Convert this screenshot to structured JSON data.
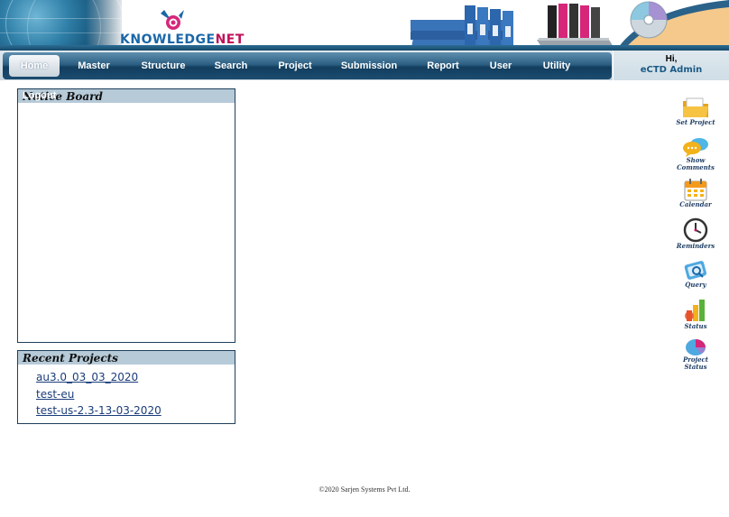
{
  "brand": {
    "name_part1": "KNOWLEDGE",
    "name_part2": "NET"
  },
  "nav": [
    {
      "label": "Home",
      "active": true
    },
    {
      "label": "Master"
    },
    {
      "label": "Structure"
    },
    {
      "label": "Search"
    },
    {
      "label": "Project"
    },
    {
      "label": "Submission"
    },
    {
      "label": "Report"
    },
    {
      "label": "User"
    },
    {
      "label": "Utility"
    }
  ],
  "user": {
    "greeting": "Hi,",
    "name": "eCTD Admin"
  },
  "notice_board": {
    "title": "Notice Board",
    "ghost_text": "Logout"
  },
  "recent_projects": {
    "title": "Recent Projects",
    "items": [
      "au3.0_03_03_2020",
      "test-eu",
      "test-us-2.3-13-03-2020"
    ]
  },
  "side_actions": [
    {
      "label": "Set Project",
      "icon": "folder-icon"
    },
    {
      "label": "Show Comments",
      "icon": "comments-icon"
    },
    {
      "label": "Calendar",
      "icon": "calendar-icon"
    },
    {
      "label": "Reminders",
      "icon": "clock-icon"
    },
    {
      "label": "Query",
      "icon": "query-icon"
    },
    {
      "label": "Status",
      "icon": "status-chart-icon"
    },
    {
      "label": "Project Status",
      "icon": "pie-chart-icon"
    }
  ],
  "footer": {
    "text": "©2020 Sarjen Systems Pvt Ltd."
  },
  "colors": {
    "nav_dark": "#123e5e",
    "brand_blue": "#1a67a8",
    "brand_magenta": "#c0125a",
    "panel_head": "#b6cad8"
  }
}
